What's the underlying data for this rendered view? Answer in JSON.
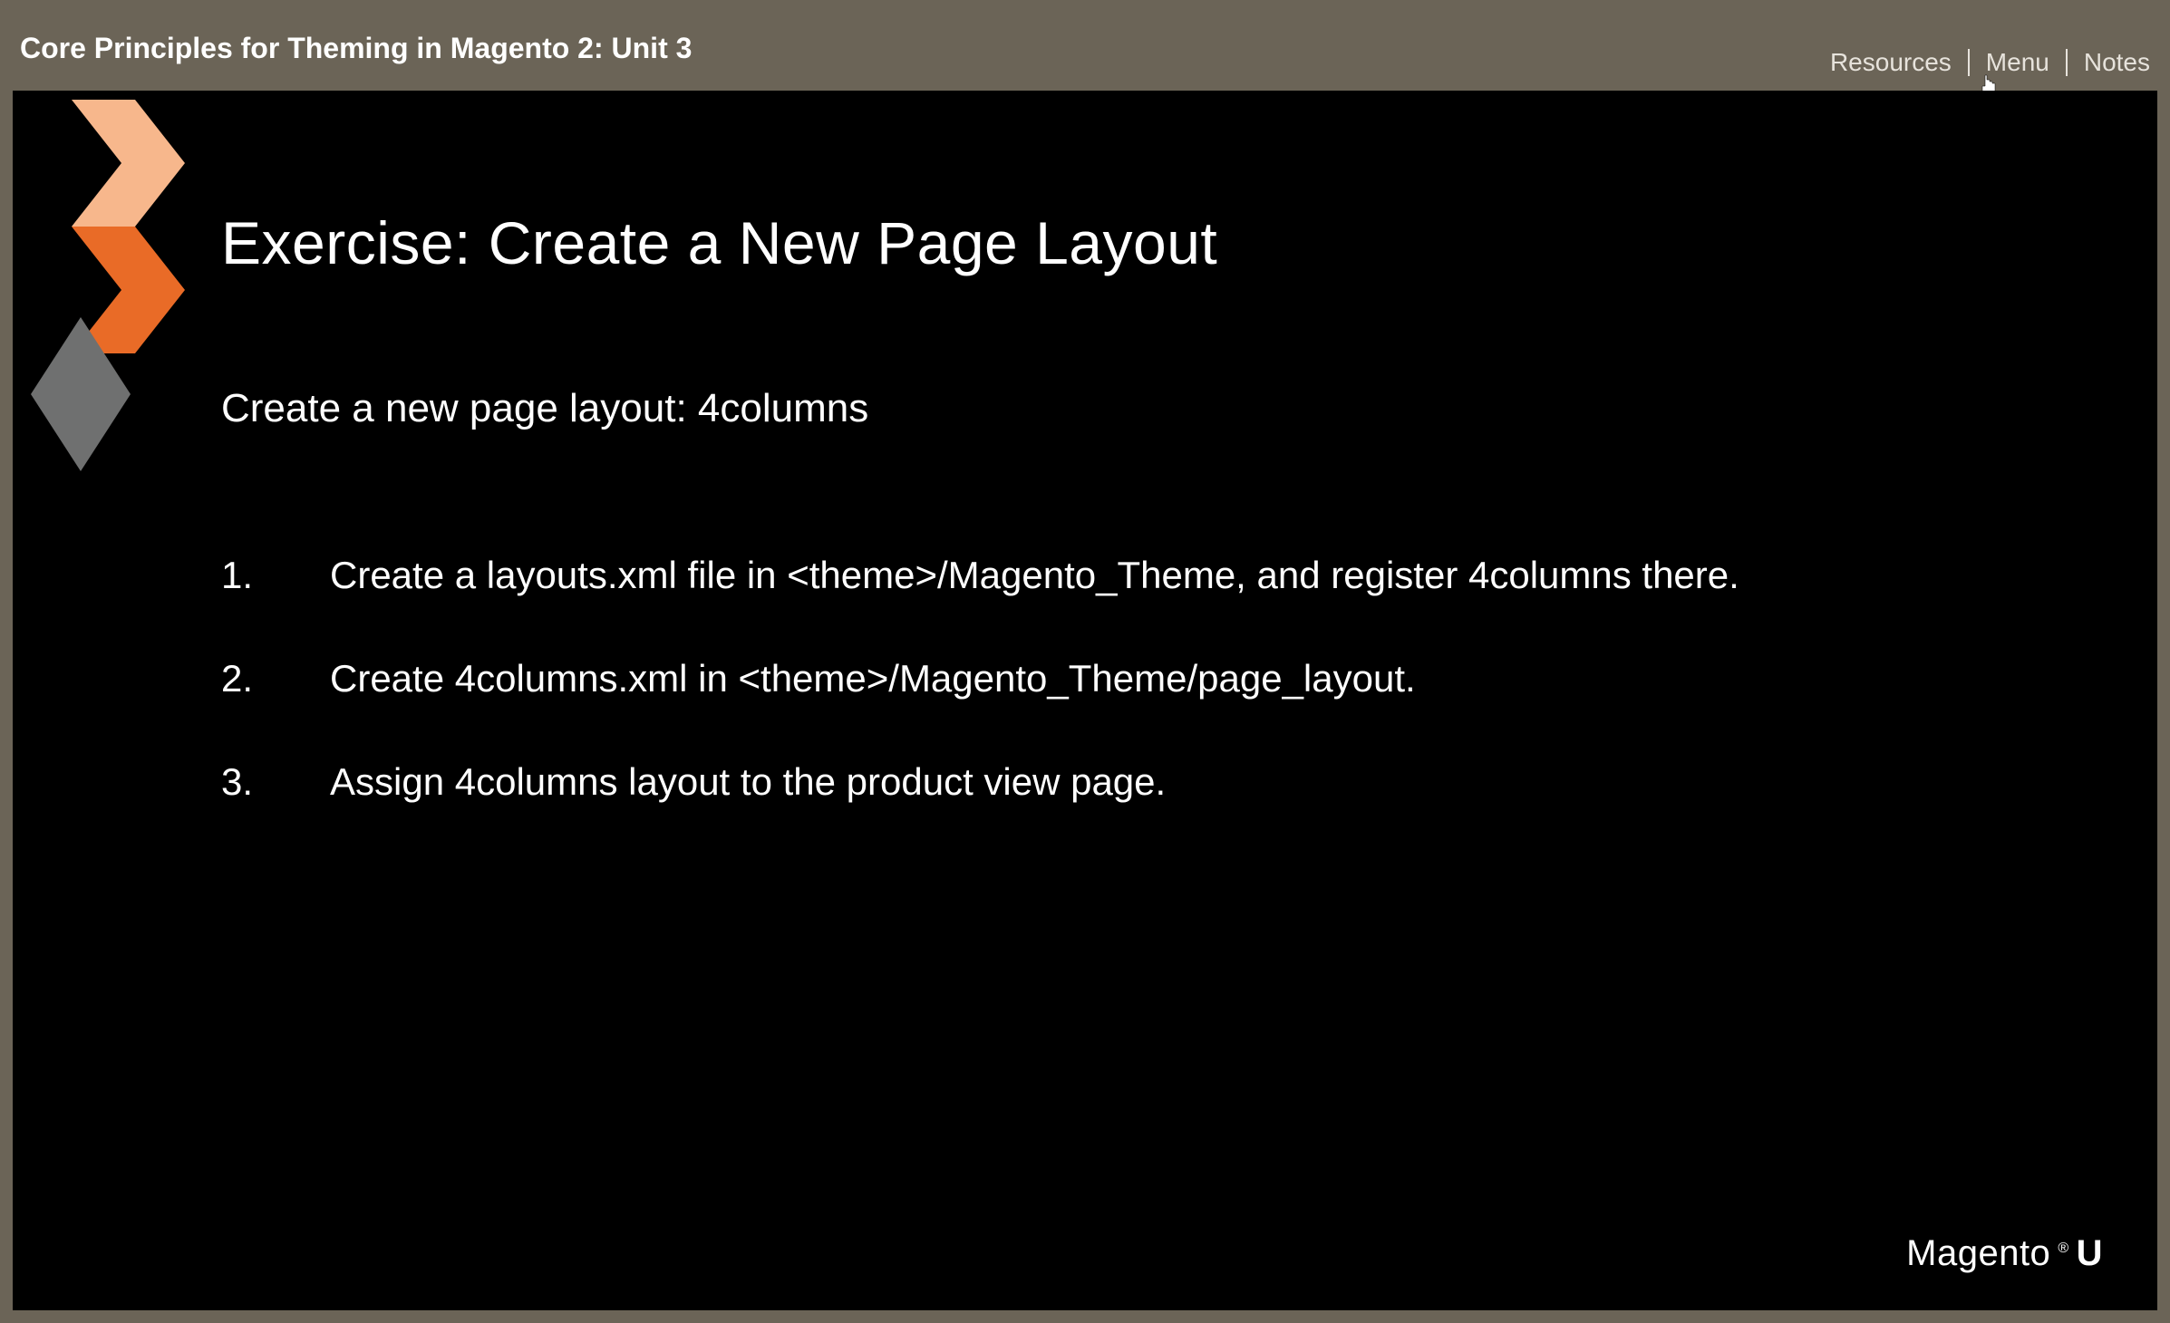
{
  "header": {
    "title": "Core Principles for Theming in Magento 2: Unit 3",
    "links": {
      "resources": "Resources",
      "menu": "Menu",
      "notes": "Notes"
    }
  },
  "slide": {
    "heading": "Exercise: Create a New Page Layout",
    "subheading": "Create a new page layout: 4columns",
    "steps": [
      "Create a layouts.xml file in <theme>/Magento_Theme, and register 4columns there.",
      "Create 4columns.xml in <theme>/Magento_Theme/page_layout.",
      "Assign 4columns layout to the product view page."
    ]
  },
  "brand": {
    "name": "Magento",
    "suffix": "U"
  },
  "logo": {
    "chevron_top_color": "#f7b78c",
    "chevron_bottom_color": "#e96b27",
    "diamond_color": "#6f7070"
  }
}
